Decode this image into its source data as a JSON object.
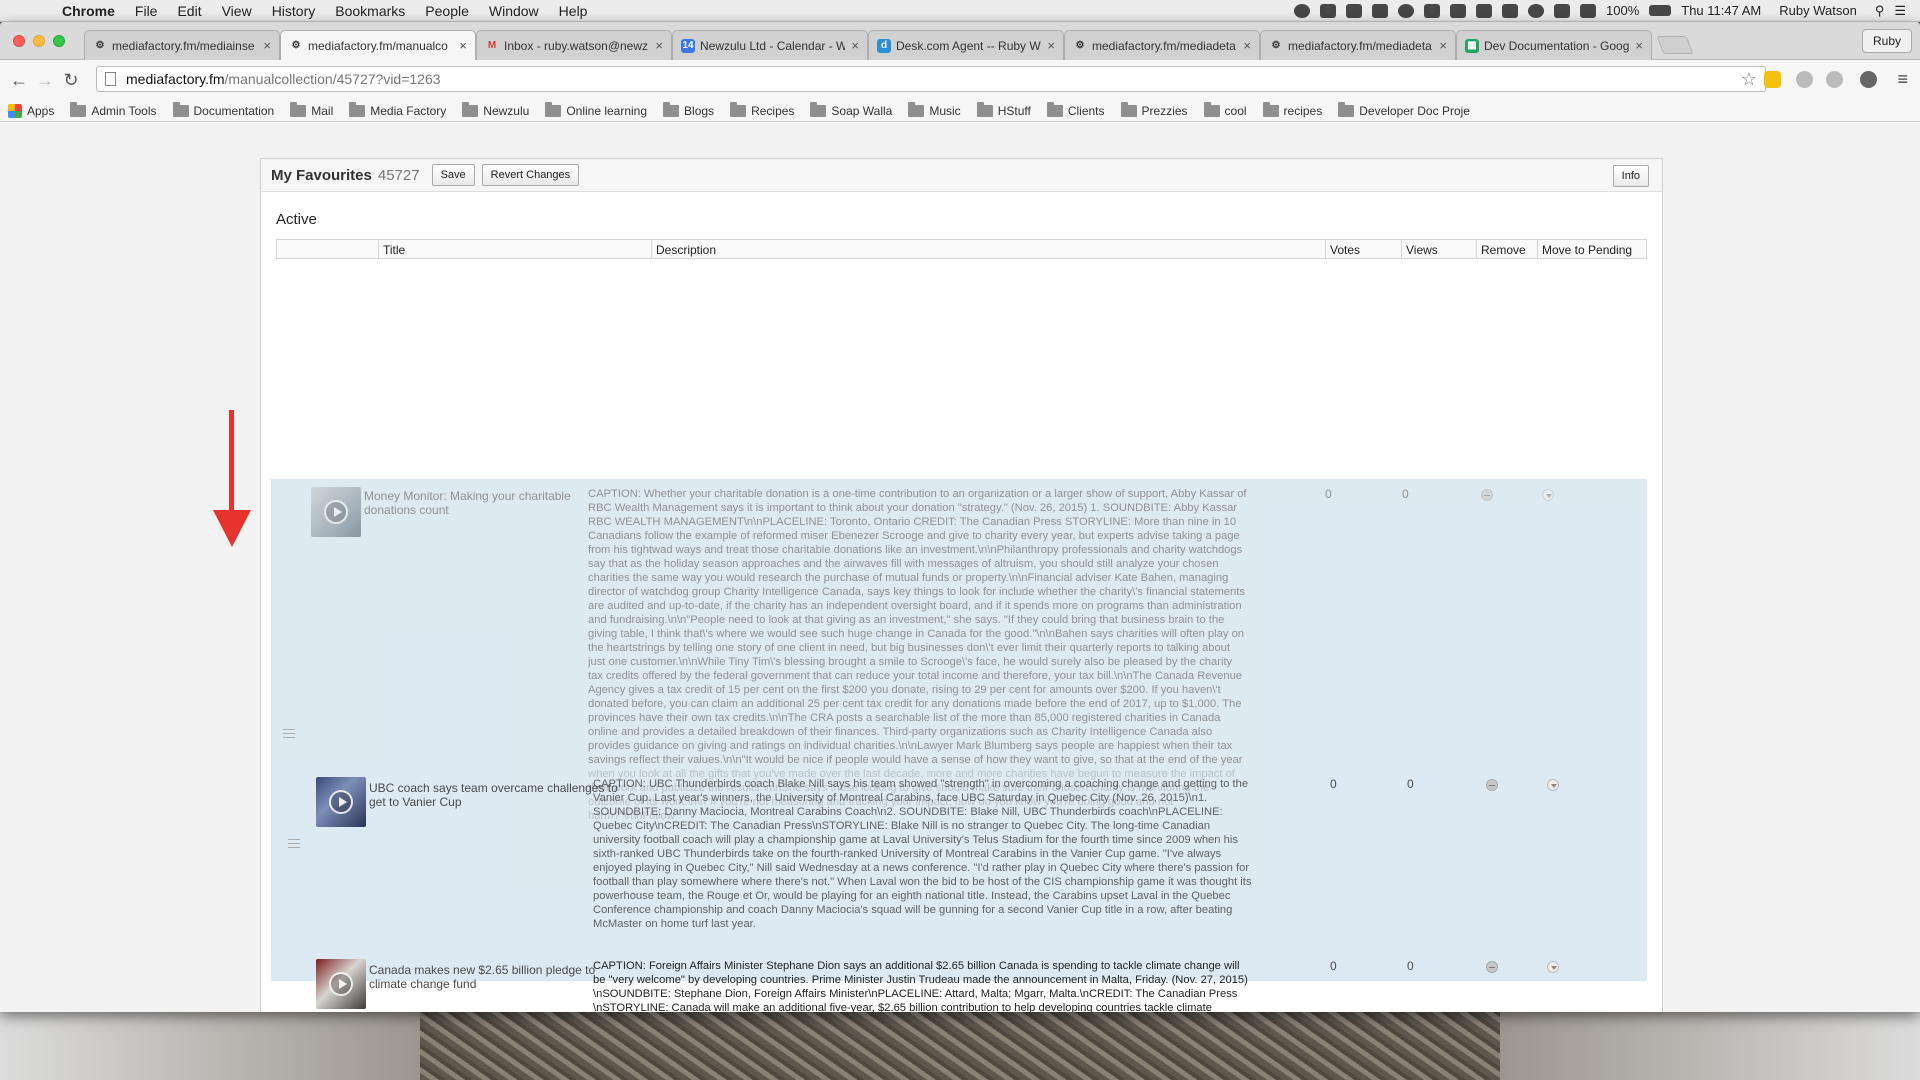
{
  "menubar": {
    "app": "Chrome",
    "items": [
      "File",
      "Edit",
      "View",
      "History",
      "Bookmarks",
      "People",
      "Window",
      "Help"
    ],
    "battery": "100%",
    "clock": "Thu 11:47 AM",
    "user": "Ruby Watson"
  },
  "tabs": [
    {
      "title": "mediafactory.fm/mediainse",
      "icon": "mediafactory-icon"
    },
    {
      "title": "mediafactory.fm/manualco",
      "icon": "mediafactory-icon"
    },
    {
      "title": "Inbox - ruby.watson@newz",
      "icon": "gmail-icon"
    },
    {
      "title": "Newzulu Ltd - Calendar - W",
      "icon": "calendar-icon"
    },
    {
      "title": "Desk.com Agent -- Ruby W",
      "icon": "desk-icon"
    },
    {
      "title": "mediafactory.fm/mediadeta",
      "icon": "mediafactory-icon"
    },
    {
      "title": "mediafactory.fm/mediadeta",
      "icon": "mediafactory-icon"
    },
    {
      "title": "Dev Documentation - Goog",
      "icon": "sheets-icon"
    }
  ],
  "profile_button": "Ruby",
  "address": {
    "host": "mediafactory.fm",
    "path": "/manualcollection/45727?vid=1263"
  },
  "bookmarks": [
    "Apps",
    "Admin Tools",
    "Documentation",
    "Mail",
    "Media Factory",
    "Newzulu",
    "Online learning",
    "Blogs",
    "Recipes",
    "Soap Walla",
    "Music",
    "HStuff",
    "Clients",
    "Prezzies",
    "cool",
    "recipes",
    "Developer Doc Proje"
  ],
  "panel": {
    "title": "My Favourites",
    "count": "45727",
    "save_label": "Save",
    "revert_label": "Revert Changes",
    "info_label": "Info",
    "section": "Active",
    "columns": [
      "",
      "Title",
      "Description",
      "Votes",
      "Views",
      "Remove",
      "Move to Pending"
    ]
  },
  "rows": [
    {
      "title": "Money Monitor: Making your charitable donations count",
      "description": "CAPTION: Whether your charitable donation is a one-time contribution to an organization or a larger show of support, Abby Kassar of RBC Wealth Management says it is important to think about your donation \"strategy.\" (Nov. 26, 2015) 1. SOUNDBITE: Abby Kassar RBC WEALTH MANAGEMENT\\n\\nPLACELINE: Toronto, Ontario CREDIT: The Canadian Press STORYLINE: More than nine in 10 Canadians follow the example of reformed miser Ebenezer Scrooge and give to charity every year, but experts advise taking a page from his tightwad ways and treat those charitable donations like an investment.\\n\\nPhilanthropy professionals and charity watchdogs say that as the holiday season approaches and the airwaves fill with messages of altruism, you should still analyze your chosen charities the same way you would research the purchase of mutual funds or property.\\n\\nFinancial adviser Kate Bahen, managing director of watchdog group Charity Intelligence Canada, says key things to look for include whether the charity\\'s financial statements are audited and up-to-date, if the charity has an independent oversight board, and if it spends more on programs than administration and fundraising.\\n\\n\"People need to look at that giving as an investment,\" she says. \"If they could bring that business brain to the giving table, I think that\\'s where we would see such huge change in Canada for the good.\"\\n\\nBahen says charities will often play on the heartstrings by telling one story of one client in need, but big businesses don\\'t ever limit their quarterly reports to talking about just one customer.\\n\\nWhile Tiny Tim\\'s blessing brought a smile to Scrooge\\'s face, he would surely also be pleased by the charity tax credits offered by the federal government that can reduce your total income and therefore, your tax bill.\\n\\nThe Canada Revenue Agency gives a tax credit of 15 per cent on the first $200 you donate, rising to 29 per cent for amounts over $200. If you haven\\'t donated before, you can claim an additional 25 per cent tax credit for any donations made before the end of 2017, up to $1,000. The provinces have their own tax credits.\\n\\nThe CRA posts a searchable list of the more than 85,000 registered charities in Canada online and provides a detailed breakdown of their finances. Third-party organizations such as Charity Intelligence Canada also provides guidance on giving and ratings on individual charities.\\n\\nLawyer Mark Blumberg says people are happiest when their tax savings reflect their values.\\n\\n\"It would be nice if people would have a sense of how they want to give, so that at the end of the year when you look at all the gifts that you've made over the last decade, more and more charities have begun to measure the impact of their work and publicize the results.\\n\\nShe says those looking to give should make sure their chosen charity is monitoring the outcome of its work.\\n\\n\"If you're not measuring and tracking your impact, how do you know you're doing good and not harm?\"\\n\\nFollow",
      "votes": "0",
      "views": "0"
    },
    {
      "title": "UBC coach says team overcame challenges to get to Vanier Cup",
      "description": "CAPTION: UBC Thunderbirds coach Blake Nill says his team showed \"strength\" in overcoming a coaching change and getting to the Vanier Cup. Last year's winners, the University of Montreal Carabins, face UBC Saturday in Quebec City (Nov. 26, 2015)\\n1. SOUNDBITE: Danny Maciocia, Montreal Carabins Coach\\n2. SOUNDBITE: Blake Nill, UBC Thunderbirds coach\\nPLACELINE: Quebec City\\nCREDIT: The Canadian Press\\nSTORYLINE: Blake Nill is no stranger to Quebec City. The long-time Canadian university football coach will play a championship game at Laval University's Telus Stadium for the fourth time since 2009 when his sixth-ranked UBC Thunderbirds take on the fourth-ranked University of Montreal Carabins in the Vanier Cup game. \"I've always enjoyed playing in Quebec City,\" Nill said Wednesday at a news conference. \"I'd rather play in Quebec City where there's passion for football than play somewhere where there's not.\" When Laval won the bid to be host of the CIS championship game it was thought its powerhouse team, the Rouge et Or, would be playing for an eighth national title. Instead, the Carabins upset Laval in the Quebec Conference championship and coach Danny Maciocia's squad will be gunning for a second Vanier Cup title in a row, after beating McMaster on home turf last year.",
      "votes": "0",
      "views": "0"
    },
    {
      "title": "Canada makes new $2.65 billion pledge to climate change fund",
      "description": "CAPTION: Foreign Affairs Minister Stephane Dion says an additional $2.65 billion Canada is spending to tackle climate change will be \"very welcome\" by developing countries. Prime Minister Justin Trudeau made the announcement in Malta, Friday. (Nov. 27, 2015) \\nSOUNDBITE: Stephane Dion, Foreign Affairs Minister\\nPLACELINE: Attard, Malta; Mgarr, Malta.\\nCREDIT: The Canadian Press \\nSTORYLINE: Canada will make an additional five-year, $2.65 billion contribution to help developing countries tackle climate change, as the battle against global warming dominated the summit of",
      "votes": "0",
      "views": "0"
    }
  ]
}
